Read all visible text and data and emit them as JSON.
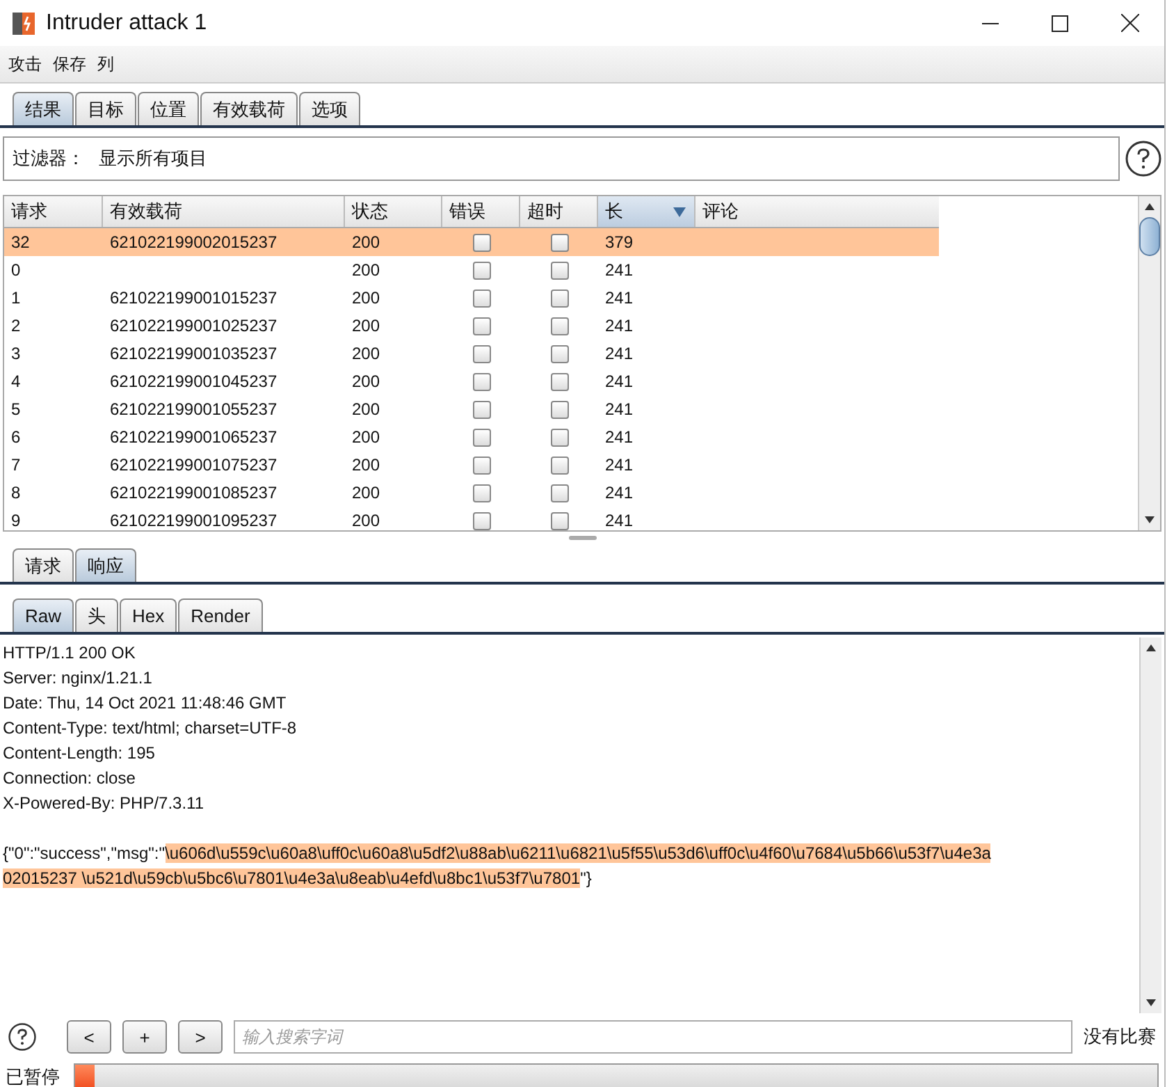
{
  "window": {
    "title": "Intruder attack 1"
  },
  "menu": [
    "攻击",
    "保存",
    "列"
  ],
  "tabs": [
    {
      "label": "结果",
      "selected": true
    },
    {
      "label": "目标",
      "selected": false
    },
    {
      "label": "位置",
      "selected": false
    },
    {
      "label": "有效载荷",
      "selected": false
    },
    {
      "label": "选项",
      "selected": false
    }
  ],
  "filter": {
    "label": "过滤器：",
    "value": "显示所有项目"
  },
  "table": {
    "columns": [
      {
        "label": "请求",
        "sorted": false
      },
      {
        "label": "有效载荷",
        "sorted": false
      },
      {
        "label": "状态",
        "sorted": false
      },
      {
        "label": "错误",
        "sorted": false
      },
      {
        "label": "超时",
        "sorted": false
      },
      {
        "label": "长",
        "sorted": true
      },
      {
        "label": "评论",
        "sorted": false
      }
    ],
    "rows": [
      {
        "request": "32",
        "payload": "621022199002015237",
        "status": "200",
        "error": false,
        "timeout": false,
        "length": "379",
        "selected": true
      },
      {
        "request": "0",
        "payload": "",
        "status": "200",
        "error": false,
        "timeout": false,
        "length": "241",
        "selected": false
      },
      {
        "request": "1",
        "payload": "621022199001015237",
        "status": "200",
        "error": false,
        "timeout": false,
        "length": "241",
        "selected": false
      },
      {
        "request": "2",
        "payload": "621022199001025237",
        "status": "200",
        "error": false,
        "timeout": false,
        "length": "241",
        "selected": false
      },
      {
        "request": "3",
        "payload": "621022199001035237",
        "status": "200",
        "error": false,
        "timeout": false,
        "length": "241",
        "selected": false
      },
      {
        "request": "4",
        "payload": "621022199001045237",
        "status": "200",
        "error": false,
        "timeout": false,
        "length": "241",
        "selected": false
      },
      {
        "request": "5",
        "payload": "621022199001055237",
        "status": "200",
        "error": false,
        "timeout": false,
        "length": "241",
        "selected": false
      },
      {
        "request": "6",
        "payload": "621022199001065237",
        "status": "200",
        "error": false,
        "timeout": false,
        "length": "241",
        "selected": false
      },
      {
        "request": "7",
        "payload": "621022199001075237",
        "status": "200",
        "error": false,
        "timeout": false,
        "length": "241",
        "selected": false
      },
      {
        "request": "8",
        "payload": "621022199001085237",
        "status": "200",
        "error": false,
        "timeout": false,
        "length": "241",
        "selected": false
      },
      {
        "request": "9",
        "payload": "621022199001095237",
        "status": "200",
        "error": false,
        "timeout": false,
        "length": "241",
        "selected": false
      }
    ]
  },
  "message_tabs": [
    {
      "label": "请求",
      "selected": false
    },
    {
      "label": "响应",
      "selected": true
    }
  ],
  "view_tabs": [
    {
      "label": "Raw",
      "selected": true
    },
    {
      "label": "头",
      "selected": false
    },
    {
      "label": "Hex",
      "selected": false
    },
    {
      "label": "Render",
      "selected": false
    }
  ],
  "response": {
    "headers": [
      "HTTP/1.1 200 OK",
      "Server: nginx/1.21.1",
      "Date: Thu, 14 Oct 2021 11:48:46 GMT",
      "Content-Type: text/html; charset=UTF-8",
      "Content-Length: 195",
      "Connection: close",
      "X-Powered-By: PHP/7.3.11"
    ],
    "body": [
      [
        {
          "text": "{\"0\":\"success\",\"msg\":\"",
          "highlighted": false
        },
        {
          "text": "\\u606d\\u559c\\u60a8\\uff0c\\u60a8\\u5df2\\u88ab\\u6211\\u6821\\u5f55\\u53d6\\uff0c\\u4f60\\u7684\\u5b66\\u53f7\\u4e3a",
          "highlighted": true
        }
      ],
      [
        {
          "text": "02015237 \\u521d\\u59cb\\u5bc6\\u7801\\u4e3a\\u8eab\\u4efd\\u8bc1\\u53f7\\u7801",
          "highlighted": true
        },
        {
          "text": "\"}",
          "highlighted": false
        }
      ]
    ]
  },
  "search": {
    "buttons": [
      "<",
      "+",
      ">"
    ],
    "placeholder": "输入搜索字词",
    "matches": "没有比赛"
  },
  "status": {
    "label": "已暂停",
    "level": 0
  }
}
